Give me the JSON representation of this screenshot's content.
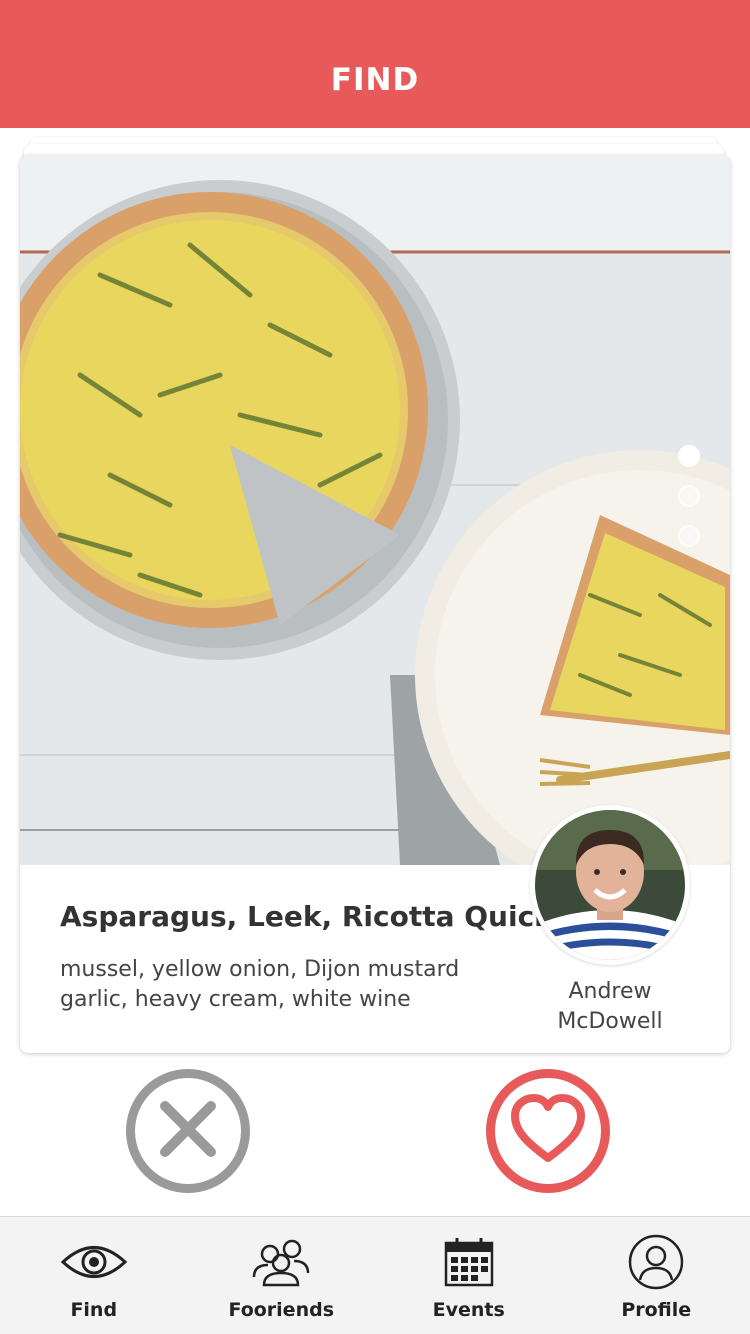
{
  "header": {
    "title": "FIND"
  },
  "card": {
    "photo_description_icon": "quiche-photo",
    "carousel": {
      "count": 3,
      "active_index": 0
    },
    "recipe_title": "Asparagus, Leek, Ricotta Quiche",
    "ingredients_line1": "mussel, yellow onion, Dijon mustard",
    "ingredients_line2": "garlic, heavy cream, white wine",
    "author_first": "Andrew",
    "author_last": "McDowell"
  },
  "actions": {
    "dislike_icon": "x-icon",
    "like_icon": "heart-icon"
  },
  "tabs": [
    {
      "label": "Find",
      "icon": "eye-icon"
    },
    {
      "label": "Fooriends",
      "icon": "friends-icon"
    },
    {
      "label": "Events",
      "icon": "calendar-icon"
    },
    {
      "label": "Profile",
      "icon": "user-icon"
    }
  ],
  "colors": {
    "accent": "#E85A5A",
    "dislike": "#9a9a9a",
    "tabbar_bg": "#f3f3f3"
  }
}
